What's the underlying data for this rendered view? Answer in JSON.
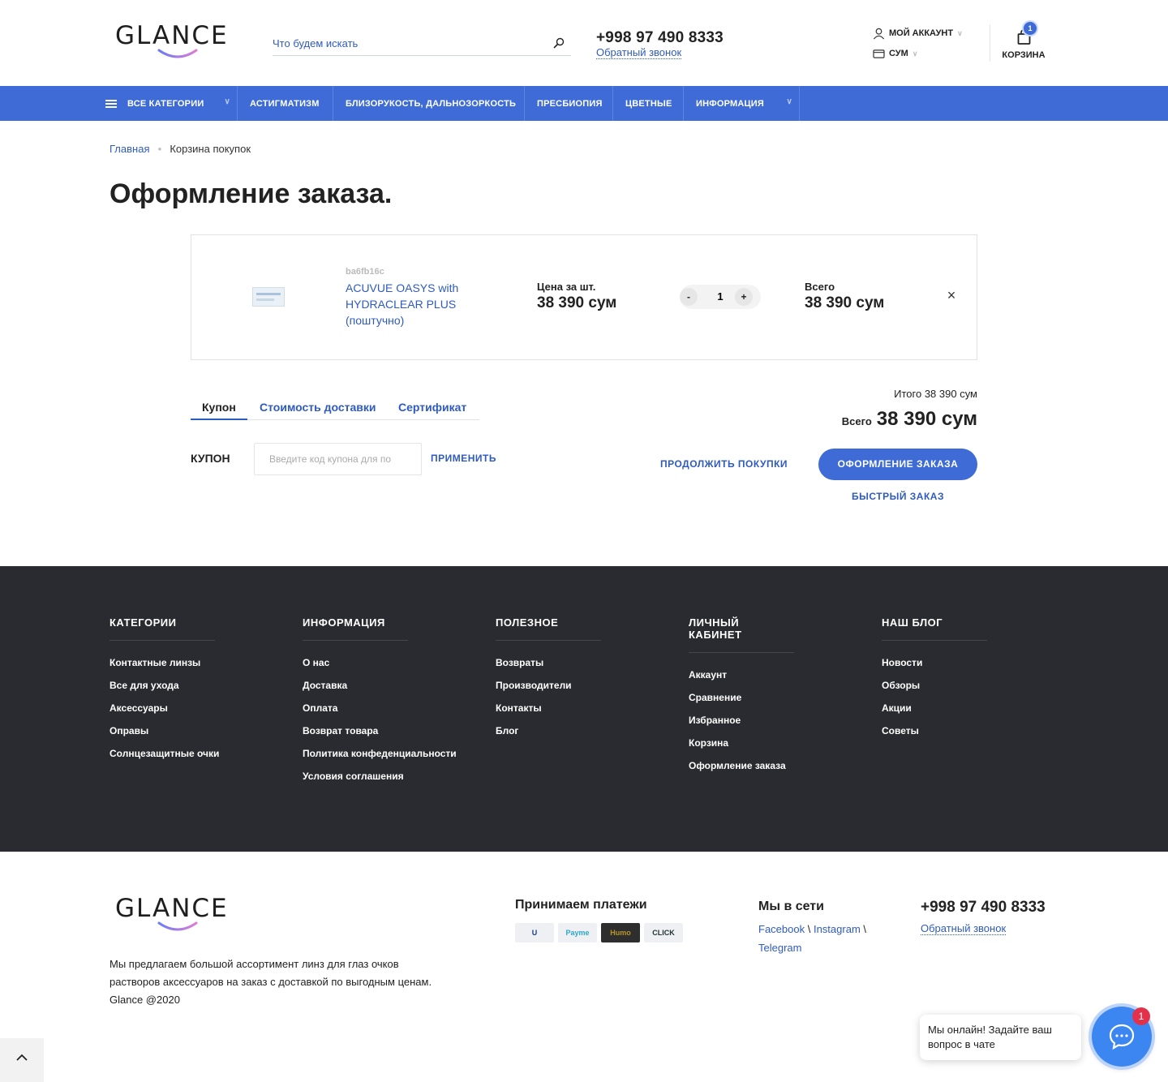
{
  "header": {
    "logo": "GLANCE",
    "search_placeholder": "Что будем искать",
    "phone": "+998 97 490 8333",
    "callback": "Обратный звонок",
    "account": "МОЙ АККАУНТ",
    "currency": "СУМ",
    "cart_label": "КОРЗИНА",
    "cart_count": "1"
  },
  "nav": {
    "items": [
      "ВСЕ КАТЕГОРИИ",
      "АСТИГМАТИЗМ",
      "БЛИЗОРУКОСТЬ, ДАЛЬНОЗОРКОСТЬ",
      "ПРЕСБИОПИЯ",
      "ЦВЕТНЫЕ",
      "ИНФОРМАЦИЯ"
    ]
  },
  "breadcrumb": {
    "home": "Главная",
    "current": "Корзина покупок"
  },
  "page_title": "Оформление заказа.",
  "cart_item": {
    "sku": "ba6fb16c",
    "name": "ACUVUE OASYS with HYDRACLEAR PLUS (поштучно)",
    "price_label": "Цена за шт.",
    "price": "38 390 сум",
    "qty": "1",
    "qty_minus": "-",
    "qty_plus": "+",
    "total_label": "Всего",
    "total": "38 390 сум",
    "remove": "×"
  },
  "tabs": [
    "Купон",
    "Стоимость доставки",
    "Сертификат"
  ],
  "coupon": {
    "label": "КУПОН",
    "placeholder": "Введите код купона для по",
    "apply": "ПРИМЕНИТЬ"
  },
  "summary": {
    "subtotal": "Итого 38 390 сум",
    "grand_label": "Всего",
    "grand_value": "38 390 сум",
    "continue": "ПРОДОЛЖИТЬ ПОКУПКИ",
    "checkout": "ОФОРМЛЕНИЕ ЗАКАЗА",
    "quick": "БЫСТРЫЙ ЗАКАЗ"
  },
  "footer_columns": [
    {
      "title": "КАТЕГОРИИ",
      "links": [
        "Контактные линзы",
        "Все для ухода",
        "Аксессуары",
        "Оправы",
        "Солнцезащитные очки"
      ]
    },
    {
      "title": "ИНФОРМАЦИЯ",
      "links": [
        "О нас",
        "Доставка",
        "Оплата",
        "Возврат товара",
        "Политика конфеденциальности",
        "Условия соглашения"
      ]
    },
    {
      "title": "ПОЛЕЗНОЕ",
      "links": [
        "Возвраты",
        "Производители",
        "Контакты",
        "Блог"
      ]
    },
    {
      "title": "ЛИЧНЫЙ КАБИНЕТ",
      "links": [
        "Аккаунт",
        "Сравнение",
        "Избранное",
        "Корзина",
        "Оформление заказа"
      ]
    },
    {
      "title": "НАШ БЛОГ",
      "links": [
        "Новости",
        "Обзоры",
        "Акции",
        "Советы"
      ]
    }
  ],
  "footer": {
    "logo": "GLANCE",
    "description": "Мы предлагаем большой ассортимент линз для глаз очков растворов аксессуаров на заказ с доставкой по выгодным ценам.",
    "copyright": "Glance @2020",
    "payments_title": "Принимаем платежи",
    "payments": [
      "U",
      "Payme",
      "Humo",
      "CLICK"
    ],
    "social_title": "Мы в сети",
    "social": {
      "facebook": "Facebook",
      "instagram": "Instagram",
      "telegram": "Telegram",
      "sep": "\\"
    },
    "phone": "+998 97 490 8333",
    "callback": "Обратный звонок"
  },
  "chat": {
    "message": "Мы онлайн! Задайте ваш вопрос в чате",
    "badge": "1"
  },
  "colors": {
    "accent": "#3e6bd6",
    "link": "#2f5bbf",
    "footer_bg": "#2a2b30",
    "badge": "#e2324b"
  }
}
